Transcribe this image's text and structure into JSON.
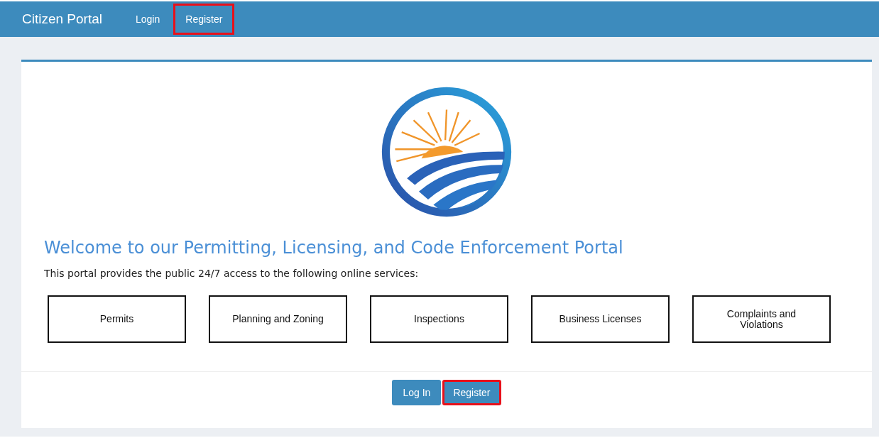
{
  "navbar": {
    "brand": "Citizen Portal",
    "links": [
      {
        "label": "Login",
        "highlighted": false
      },
      {
        "label": "Register",
        "highlighted": true
      }
    ]
  },
  "welcome": {
    "heading": "Welcome to our Permitting, Licensing, and Code Enforcement Portal",
    "intro": "This portal provides the public 24/7 access to the following online services:"
  },
  "services": [
    "Permits",
    "Planning and Zoning",
    "Inspections",
    "Business Licenses",
    "Complaints and Violations"
  ],
  "buttons": [
    {
      "label": "Log In",
      "highlighted": false
    },
    {
      "label": "Register",
      "highlighted": true
    }
  ]
}
